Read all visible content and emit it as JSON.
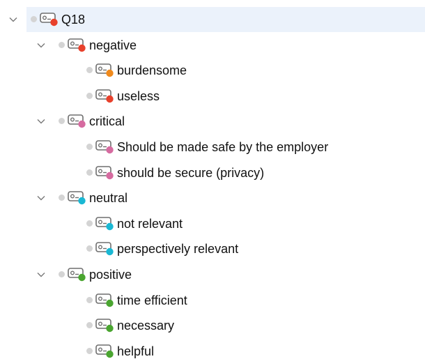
{
  "tree": {
    "root": {
      "label": "Q18",
      "color": "#e8412c",
      "expanded": true,
      "selected": true,
      "children": [
        {
          "label": "negative",
          "color": "#e8412c",
          "expanded": true,
          "children": [
            {
              "label": "burdensome",
              "color": "#f08a1c"
            },
            {
              "label": "useless",
              "color": "#e8412c"
            }
          ]
        },
        {
          "label": "critical",
          "color": "#d66ba0",
          "expanded": true,
          "children": [
            {
              "label": "Should be made safe by the employer",
              "color": "#d66ba0"
            },
            {
              "label": "should be secure (privacy)",
              "color": "#d66ba0"
            }
          ]
        },
        {
          "label": "neutral",
          "color": "#1ab8d4",
          "expanded": true,
          "children": [
            {
              "label": "not relevant",
              "color": "#1ab8d4"
            },
            {
              "label": "perspectively relevant",
              "color": "#1ab8d4"
            }
          ]
        },
        {
          "label": "positive",
          "color": "#4aa530",
          "expanded": true,
          "children": [
            {
              "label": "time efficient",
              "color": "#4aa530"
            },
            {
              "label": "necessary",
              "color": "#4aa530"
            },
            {
              "label": "helpful",
              "color": "#4aa530"
            }
          ]
        }
      ]
    },
    "icons": {
      "expander": "chevron-down-icon",
      "status": "status-dot-icon",
      "code": "code-tag-icon"
    }
  }
}
